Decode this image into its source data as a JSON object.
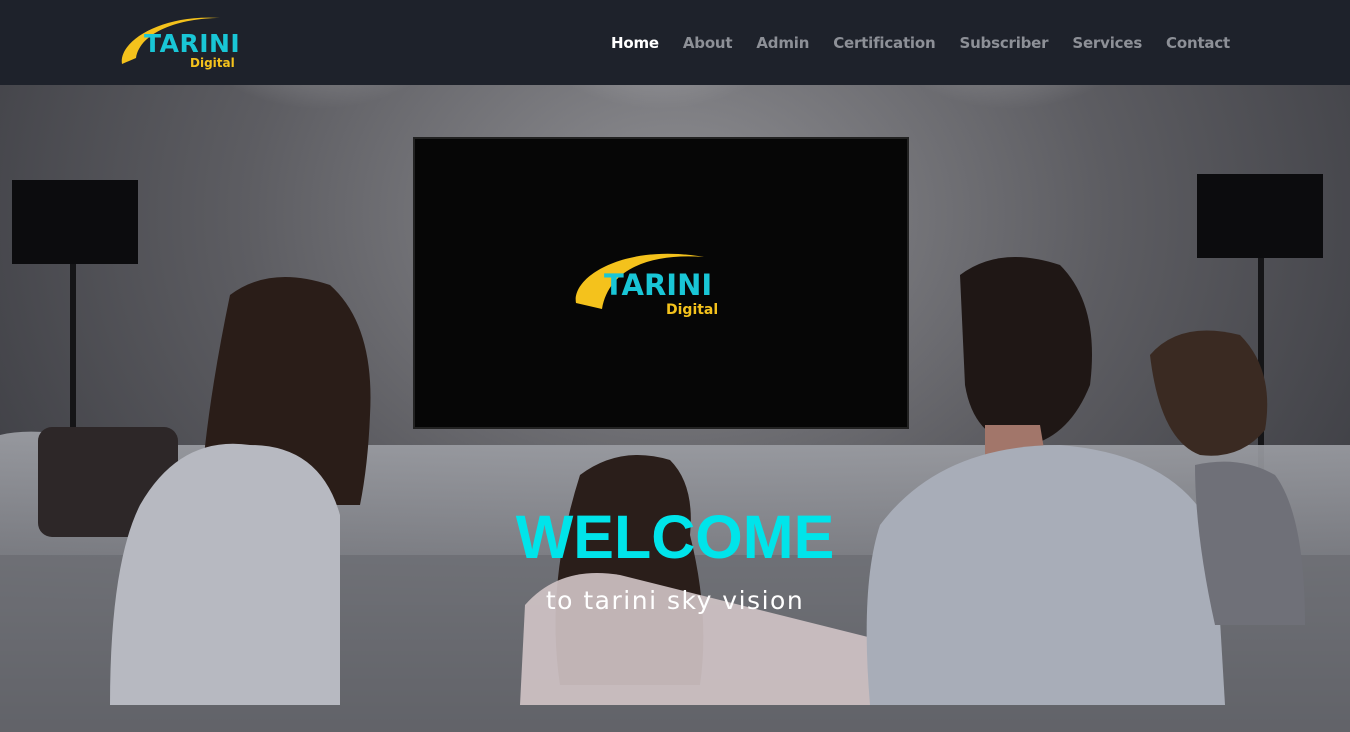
{
  "brand": {
    "name": "TARINI",
    "subname": "Digital",
    "colors": {
      "primary_cyan": "#19c6d6",
      "accent_yellow": "#f4c21c",
      "nav_bg": "#1e222b",
      "welcome_cyan": "#00e4ea"
    }
  },
  "nav": {
    "items": [
      {
        "label": "Home",
        "active": true
      },
      {
        "label": "About",
        "active": false
      },
      {
        "label": "Admin",
        "active": false
      },
      {
        "label": "Certification",
        "active": false
      },
      {
        "label": "Subscriber",
        "active": false
      },
      {
        "label": "Services",
        "active": false
      },
      {
        "label": "Contact",
        "active": false
      }
    ]
  },
  "hero": {
    "title": "WELCOME",
    "subtitle": "to tarini sky vision",
    "tv_logo": {
      "name": "TARINI",
      "subname": "Digital"
    }
  }
}
